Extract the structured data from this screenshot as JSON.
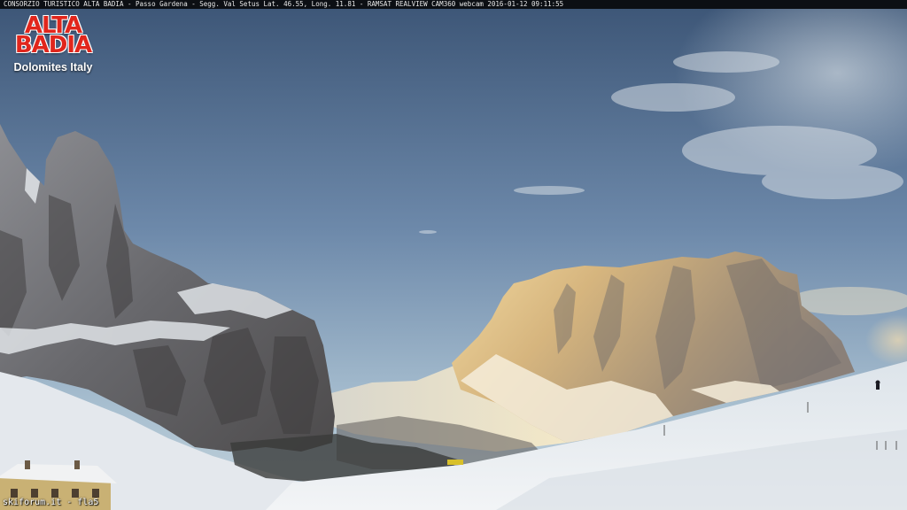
{
  "header": {
    "caption": "CONSORZIO TURISTICO ALTA BADIA - Passo Gardena - Segg. Val Setus  Lat. 46.55, Long. 11.81 - RAMSAT REALVIEW CAM360 webcam 2016-01-12 09:11:55"
  },
  "logo": {
    "line1": "ALTA",
    "line2": "BADIA",
    "subtitle": "Dolomites Italy",
    "color": "#e1261c"
  },
  "watermark": {
    "text": "skiforum.it - fla5"
  }
}
